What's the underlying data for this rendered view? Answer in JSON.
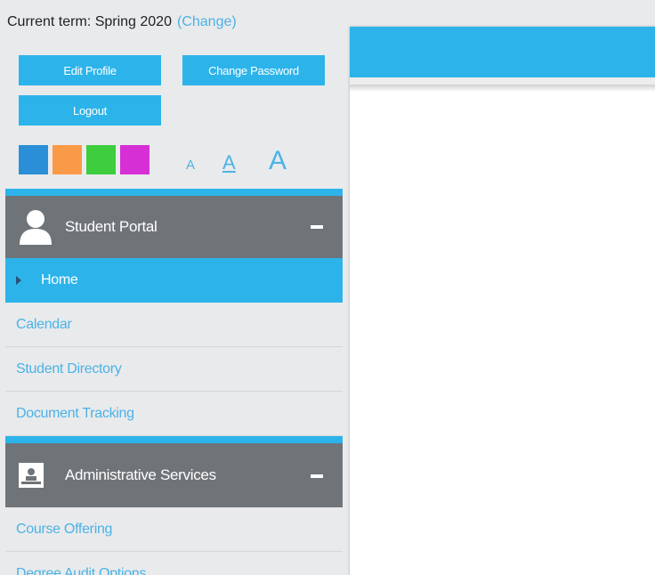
{
  "header": {
    "current_term_label": "Current term: Spring 2020",
    "change_link": "(Change)"
  },
  "buttons": {
    "edit_profile": "Edit Profile",
    "change_password": "Change Password",
    "logout": "Logout"
  },
  "theme_swatches": [
    "#2b8fd7",
    "#fb9a46",
    "#3dcd3d",
    "#d62fd6"
  ],
  "font_size_options": [
    "A",
    "A",
    "A"
  ],
  "sections": [
    {
      "title": "Student Portal",
      "icon": "user-icon",
      "items": [
        "Home",
        "Calendar",
        "Student Directory",
        "Document Tracking"
      ],
      "active_item": "Home"
    },
    {
      "title": "Administrative Services",
      "icon": "admin-services-icon",
      "items": [
        "Course Offering",
        "Degree Audit Options"
      ]
    }
  ],
  "colors": {
    "accent": "#2cb4ea",
    "section_header": "#6f7479",
    "link": "#4ab3e6",
    "sidebar_bg": "#e9eaec"
  }
}
